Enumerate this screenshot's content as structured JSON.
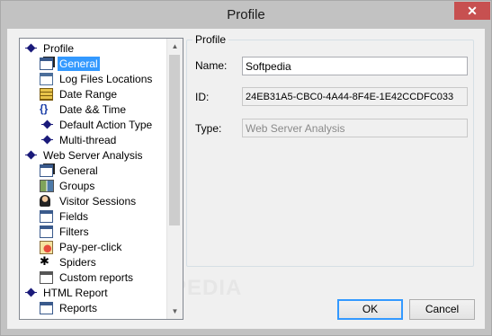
{
  "window": {
    "title": "Profile",
    "close_glyph": "✕"
  },
  "tree": {
    "items": [
      {
        "label": "Profile",
        "icon": "diamond-icon",
        "level": 0
      },
      {
        "label": "General",
        "icon": "general-icon",
        "level": 1,
        "selected": true
      },
      {
        "label": "Log Files Locations",
        "icon": "log-files-icon",
        "level": 1
      },
      {
        "label": "Date Range",
        "icon": "calendar-icon",
        "level": 1
      },
      {
        "label": "Date && Time",
        "icon": "braces-icon",
        "level": 1
      },
      {
        "label": "Default Action Type",
        "icon": "diamond-icon",
        "level": 1
      },
      {
        "label": "Multi-thread",
        "icon": "diamond-icon",
        "level": 1
      },
      {
        "label": "Web Server Analysis",
        "icon": "diamond-icon",
        "level": 0
      },
      {
        "label": "General",
        "icon": "general-icon",
        "level": 1
      },
      {
        "label": "Groups",
        "icon": "groups-icon",
        "level": 1
      },
      {
        "label": "Visitor Sessions",
        "icon": "visitor-icon",
        "level": 1
      },
      {
        "label": "Fields",
        "icon": "fields-icon",
        "level": 1
      },
      {
        "label": "Filters",
        "icon": "filters-icon",
        "level": 1
      },
      {
        "label": "Pay-per-click",
        "icon": "pay-per-click-icon",
        "level": 1
      },
      {
        "label": "Spiders",
        "icon": "spider-icon",
        "level": 1
      },
      {
        "label": "Custom reports",
        "icon": "custom-reports-icon",
        "level": 1
      },
      {
        "label": "HTML Report",
        "icon": "diamond-icon",
        "level": 0
      },
      {
        "label": "Reports",
        "icon": "reports-icon",
        "level": 1
      }
    ]
  },
  "profile_group": {
    "title": "Profile",
    "name_label": "Name:",
    "name_value": "Softpedia",
    "id_label": "ID:",
    "id_value": "24EB31A5-CBC0-4A44-8F4E-1E42CCDFC033",
    "type_label": "Type:",
    "type_value": "Web Server Analysis"
  },
  "buttons": {
    "ok": "OK",
    "cancel": "Cancel"
  },
  "watermark": "SOFTPEDIA",
  "colors": {
    "selection": "#3399ff",
    "close": "#c75050"
  }
}
